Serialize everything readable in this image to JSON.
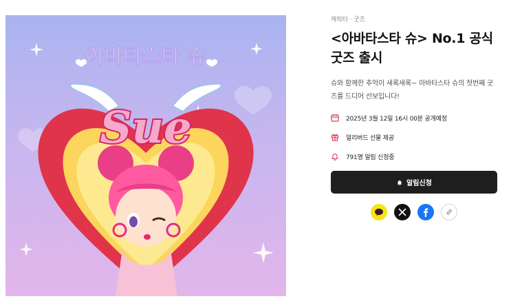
{
  "hero": {
    "korean_title": "아바타스타 슈",
    "logo_text": "Sue"
  },
  "product": {
    "breadcrumb": "캐릭터 · 굿즈",
    "title_line1": "<아바타스타 슈> No.1 공식",
    "title_line2": "굿즈 출시",
    "description_line1": "슈와 함께한 추억이 새록새록~ 아바타스타 슈의 첫번째 굿",
    "description_line2": "즈를 드디어 선보입니다!"
  },
  "info": [
    {
      "icon": "calendar-icon",
      "text": "2025년 3월 12일 16시 00분 공개예정"
    },
    {
      "icon": "gift-icon",
      "text": "얼리버드 선물 제공"
    },
    {
      "icon": "bell-icon",
      "text": "791명 알림 신청중"
    }
  ],
  "cta": {
    "label": "알림신청",
    "icon": "bell-icon"
  },
  "share": [
    {
      "icon": "kakaotalk-icon"
    },
    {
      "icon": "x-icon"
    },
    {
      "icon": "facebook-icon"
    },
    {
      "icon": "link-icon"
    }
  ],
  "colors": {
    "accent_red": "#e0344b",
    "button_bg": "#1e1e1e",
    "kakao_yellow": "#f7e317",
    "facebook_blue": "#1877f2"
  }
}
